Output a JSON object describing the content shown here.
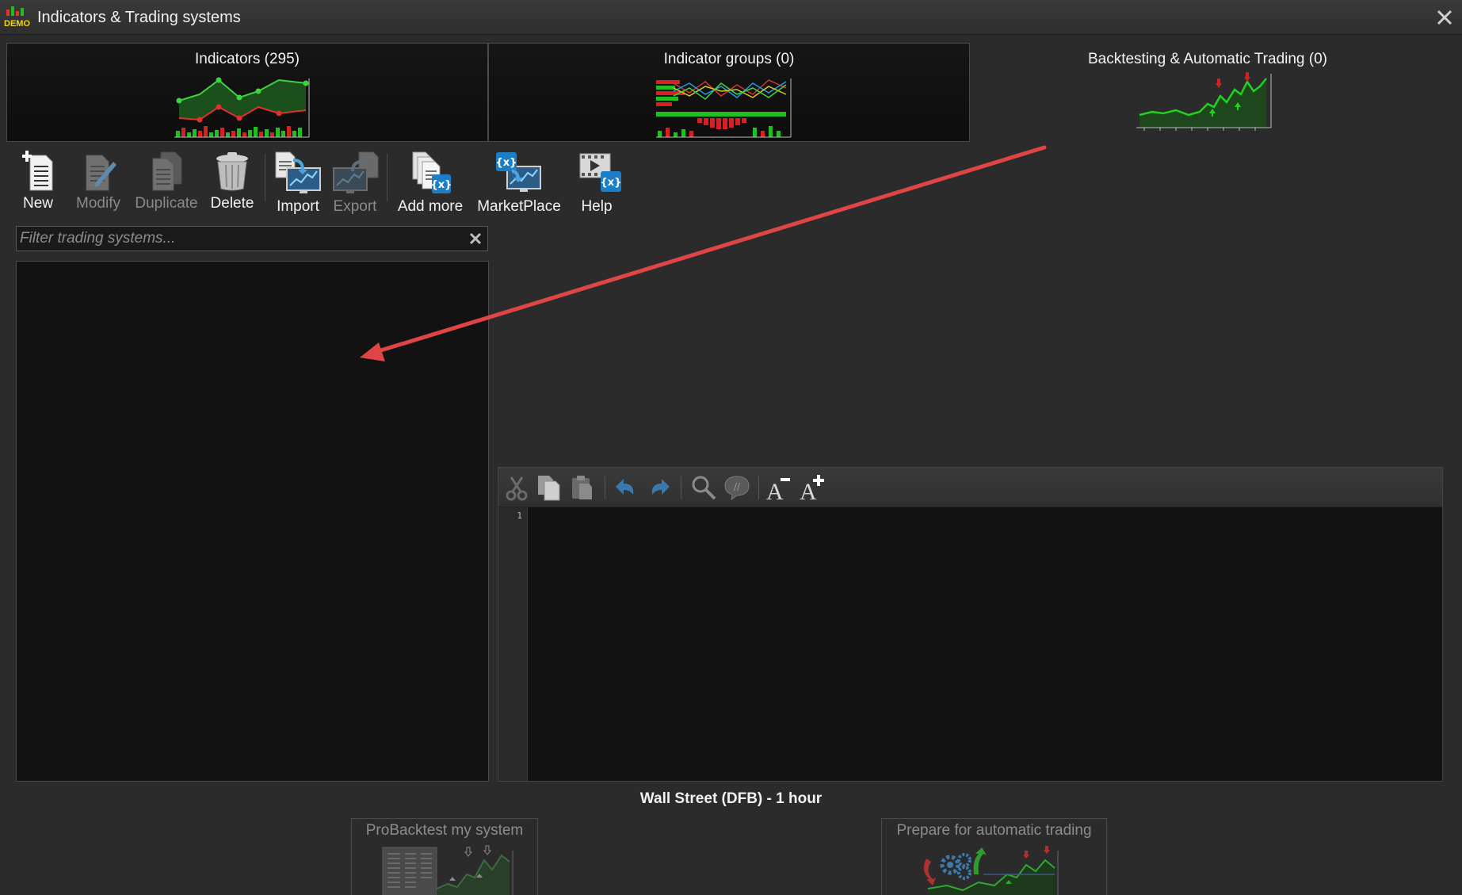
{
  "window": {
    "title": "Indicators & Trading systems",
    "logo_text": "DEMO"
  },
  "tabs": [
    {
      "label": "Indicators (295)"
    },
    {
      "label": "Indicator groups (0)"
    },
    {
      "label": "Backtesting & Automatic Trading (0)"
    }
  ],
  "toolbar": {
    "new": "New",
    "modify": "Modify",
    "duplicate": "Duplicate",
    "delete": "Delete",
    "import": "Import",
    "export": "Export",
    "add_more": "Add more",
    "marketplace": "MarketPlace",
    "help": "Help"
  },
  "filter": {
    "placeholder": "Filter trading systems..."
  },
  "editor": {
    "line_numbers": [
      "1"
    ]
  },
  "instrument": "Wall Street (DFB) - 1 hour",
  "actions": {
    "probacktest": "ProBacktest my system",
    "prepare_auto": "Prepare for automatic trading"
  },
  "colors": {
    "annotation_arrow": "#e04545",
    "accent_green": "#1fbf1f",
    "accent_red": "#d82020",
    "icon_blue": "#1d7ec8"
  }
}
